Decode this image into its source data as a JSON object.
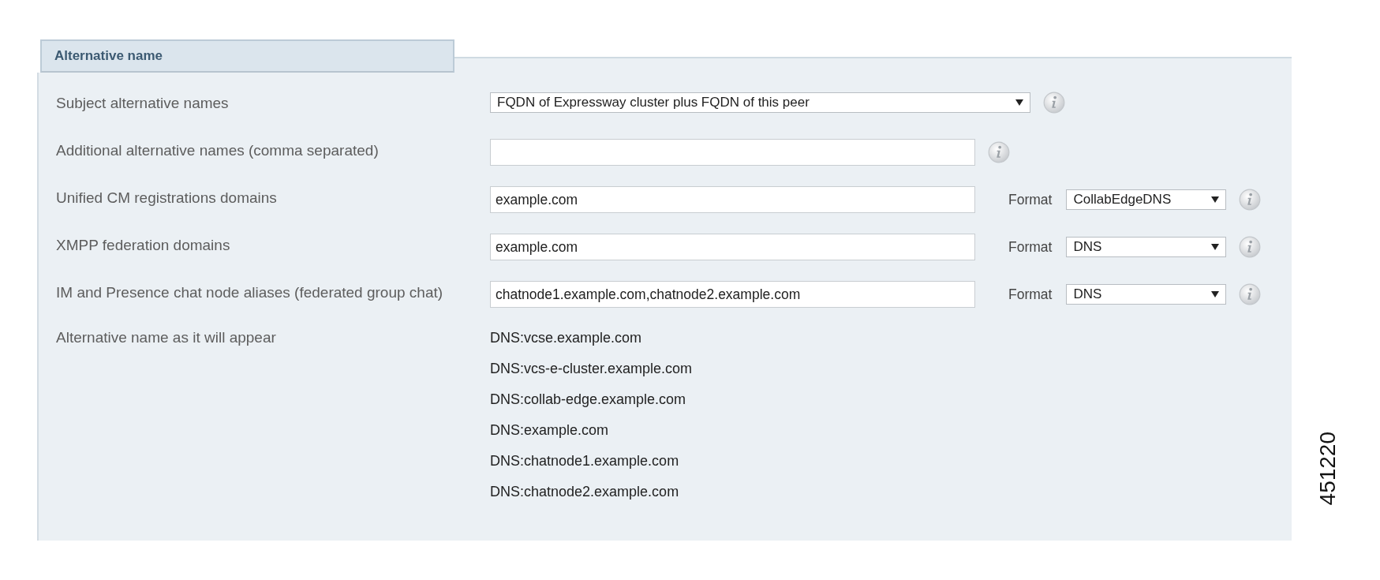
{
  "section": {
    "title": "Alternative name"
  },
  "rows": [
    {
      "label": "Subject alternative names",
      "kind": "select",
      "value": "FQDN of Expressway cluster plus FQDN of this peer"
    },
    {
      "label": "Additional alternative names (comma separated)",
      "kind": "input",
      "value": ""
    },
    {
      "label": "Unified CM registrations domains",
      "kind": "input-format",
      "value": "example.com",
      "format_label": "Format",
      "format": "CollabEdgeDNS"
    },
    {
      "label": "XMPP federation domains",
      "kind": "input-format",
      "value": "example.com",
      "format_label": "Format",
      "format": "DNS"
    },
    {
      "label": "IM and Presence chat node aliases (federated group chat)",
      "kind": "input-format",
      "value": "chatnode1.example.com,chatnode2.example.com",
      "format_label": "Format",
      "format": "DNS"
    }
  ],
  "preview": {
    "label": "Alternative name as it will appear",
    "values": [
      "DNS:vcse.example.com",
      "DNS:vcs-e-cluster.example.com",
      "DNS:collab-edge.example.com",
      "DNS:example.com",
      "DNS:chatnode1.example.com",
      "DNS:chatnode2.example.com"
    ]
  },
  "figure_id": "451220"
}
